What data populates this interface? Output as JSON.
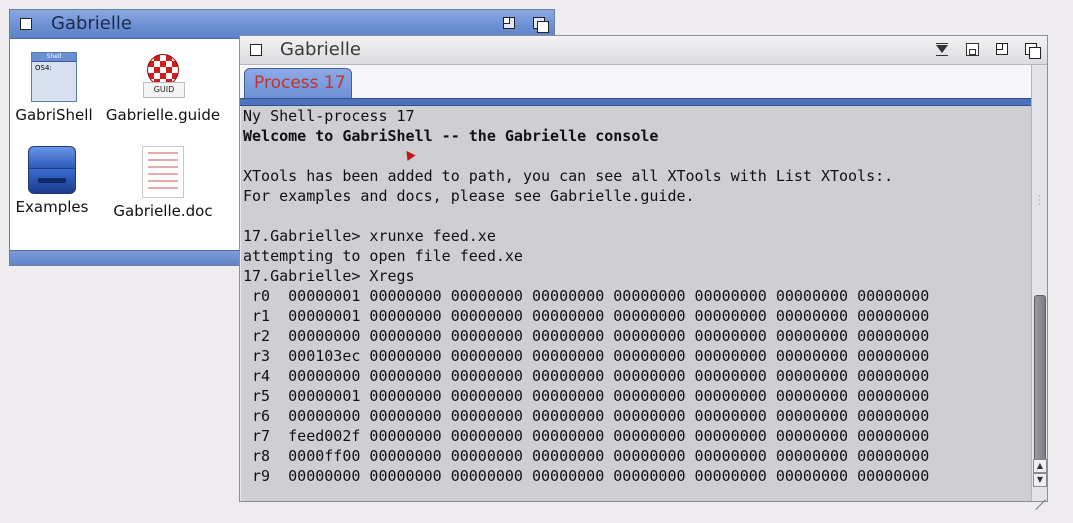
{
  "drawer": {
    "title": "Gabrielle",
    "icons": [
      {
        "label": "GabriShell",
        "icon": "shell-icon",
        "mini_title": "Shell",
        "mini_text": "OS4:"
      },
      {
        "label": "Gabrielle.guide",
        "icon": "amigaguide-icon",
        "badge": "GUID"
      },
      {
        "label": "Examples",
        "icon": "drawer-icon"
      },
      {
        "label": "Gabrielle.doc",
        "icon": "document-icon"
      }
    ]
  },
  "console": {
    "title": "Gabrielle",
    "tab": "Process 17",
    "lines": [
      {
        "text": "Ny Shell-process 17",
        "bold": false
      },
      {
        "text": "Welcome to GabriShell -- the Gabrielle console",
        "bold": true
      },
      {
        "text": "",
        "bold": false
      },
      {
        "text": "XTools has been added to path, you can see all XTools with List XTools:.",
        "bold": false
      },
      {
        "text": "For examples and docs, please see Gabrielle.guide.",
        "bold": false
      },
      {
        "text": "",
        "bold": false
      },
      {
        "text": "17.Gabrielle> xrunxe feed.xe",
        "bold": false
      },
      {
        "text": "attempting to open file feed.xe",
        "bold": false
      },
      {
        "text": "17.Gabrielle> Xregs",
        "bold": false
      },
      {
        "text": " r0  00000001 00000000 00000000 00000000 00000000 00000000 00000000 00000000",
        "bold": false
      },
      {
        "text": " r1  00000001 00000000 00000000 00000000 00000000 00000000 00000000 00000000",
        "bold": false
      },
      {
        "text": " r2  00000000 00000000 00000000 00000000 00000000 00000000 00000000 00000000",
        "bold": false
      },
      {
        "text": " r3  000103ec 00000000 00000000 00000000 00000000 00000000 00000000 00000000",
        "bold": false
      },
      {
        "text": " r4  00000000 00000000 00000000 00000000 00000000 00000000 00000000 00000000",
        "bold": false
      },
      {
        "text": " r5  00000001 00000000 00000000 00000000 00000000 00000000 00000000 00000000",
        "bold": false
      },
      {
        "text": " r6  00000000 00000000 00000000 00000000 00000000 00000000 00000000 00000000",
        "bold": false
      },
      {
        "text": " r7  feed002f 00000000 00000000 00000000 00000000 00000000 00000000 00000000",
        "bold": false
      },
      {
        "text": " r8  0000ff00 00000000 00000000 00000000 00000000 00000000 00000000 00000000",
        "bold": false
      },
      {
        "text": " r9  00000000 00000000 00000000 00000000 00000000 00000000 00000000 00000000",
        "bold": false
      }
    ]
  },
  "colors": {
    "tab_text": "#c0342a",
    "accent_blue": "#6b8fd3",
    "terminal_bg": "#cfcfd3"
  }
}
